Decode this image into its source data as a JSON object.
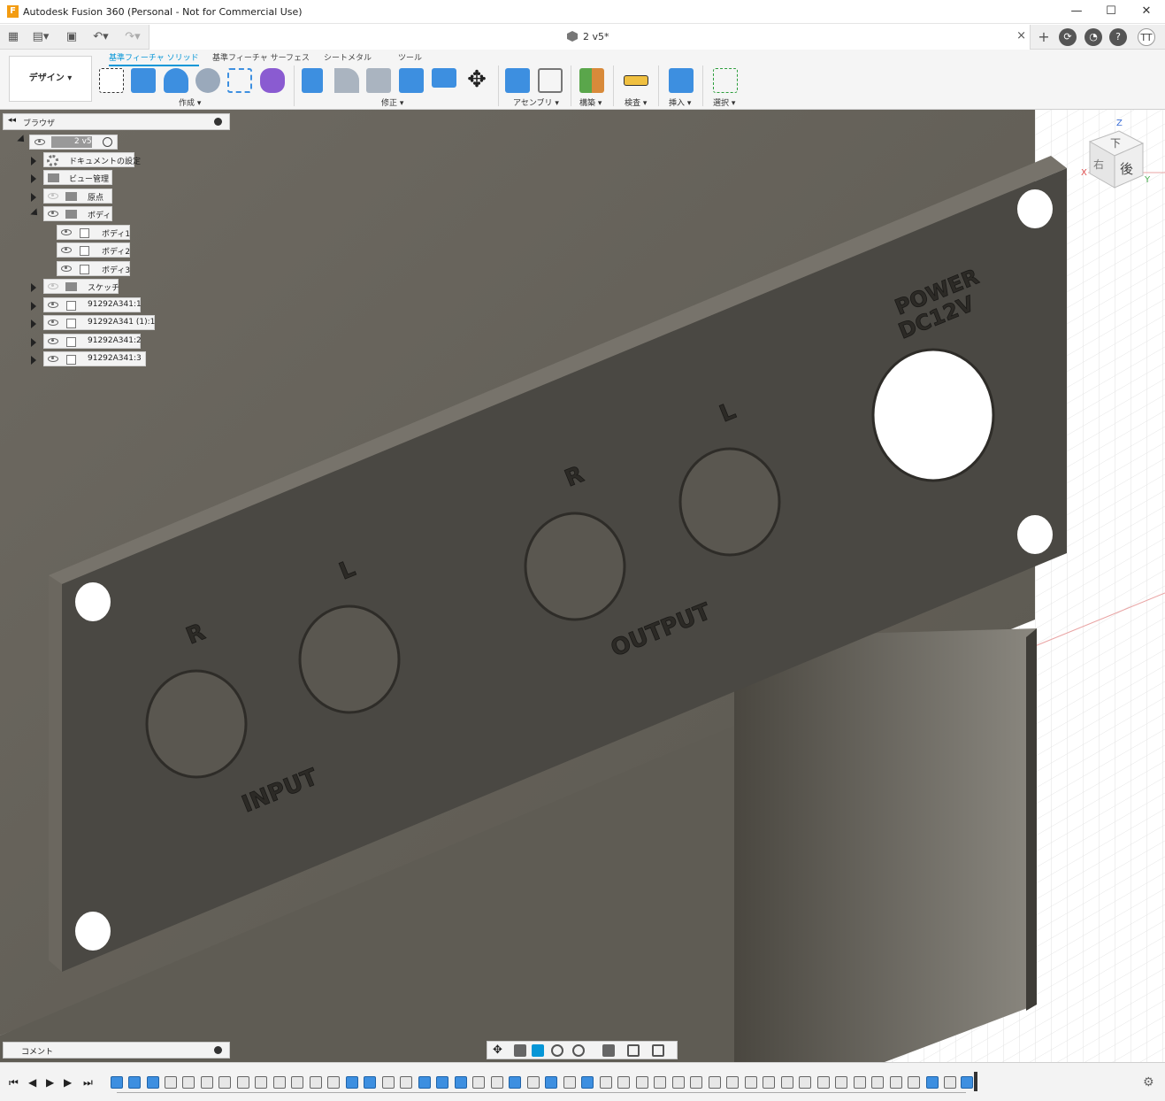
{
  "window": {
    "title": "Autodesk Fusion 360 (Personal - Not for Commercial Use)",
    "logo_letter": "F",
    "minimize": "—",
    "maximize": "☐",
    "close": "✕"
  },
  "tabbar": {
    "doc_title": "2 v5*",
    "close": "×",
    "new_tab": "+",
    "user_initials": "TT",
    "help": "?"
  },
  "ribbon": {
    "workspace": "デザイン ▾",
    "tabs": [
      "基準フィーチャ ソリッド",
      "基準フィーチャ サーフェス",
      "シートメタル",
      "ツール"
    ],
    "groups": [
      "作成 ▾",
      "修正 ▾",
      "アセンブリ ▾",
      "構築 ▾",
      "検査 ▾",
      "挿入 ▾",
      "選択 ▾"
    ]
  },
  "browser": {
    "title": "ブラウザ",
    "root": "2 v5",
    "items": [
      {
        "label": "ドキュメントの設定"
      },
      {
        "label": "ビュー管理"
      },
      {
        "label": "原点"
      },
      {
        "label": "ボディ"
      },
      {
        "label": "ボディ1"
      },
      {
        "label": "ボディ2"
      },
      {
        "label": "ボディ3"
      },
      {
        "label": "スケッチ"
      },
      {
        "label": "91292A341:1"
      },
      {
        "label": "91292A341 (1):1"
      },
      {
        "label": "91292A341:2"
      },
      {
        "label": "91292A341:3"
      }
    ]
  },
  "viewcube": {
    "top": "下",
    "right": "後",
    "left": "右",
    "z": "Z",
    "x": "X",
    "y": "Y"
  },
  "panel_text": {
    "input": "INPUT",
    "output": "OUTPUT",
    "power": "POWER",
    "dc": "DC12V",
    "r1": "R",
    "l1": "L",
    "r2": "R",
    "l2": "L"
  },
  "comment": {
    "label": "コメント"
  },
  "colors": {
    "accent": "#0696d7",
    "panel": "#4a4843",
    "panel_edge": "#6b675f",
    "grid": "#e6e6e6"
  }
}
